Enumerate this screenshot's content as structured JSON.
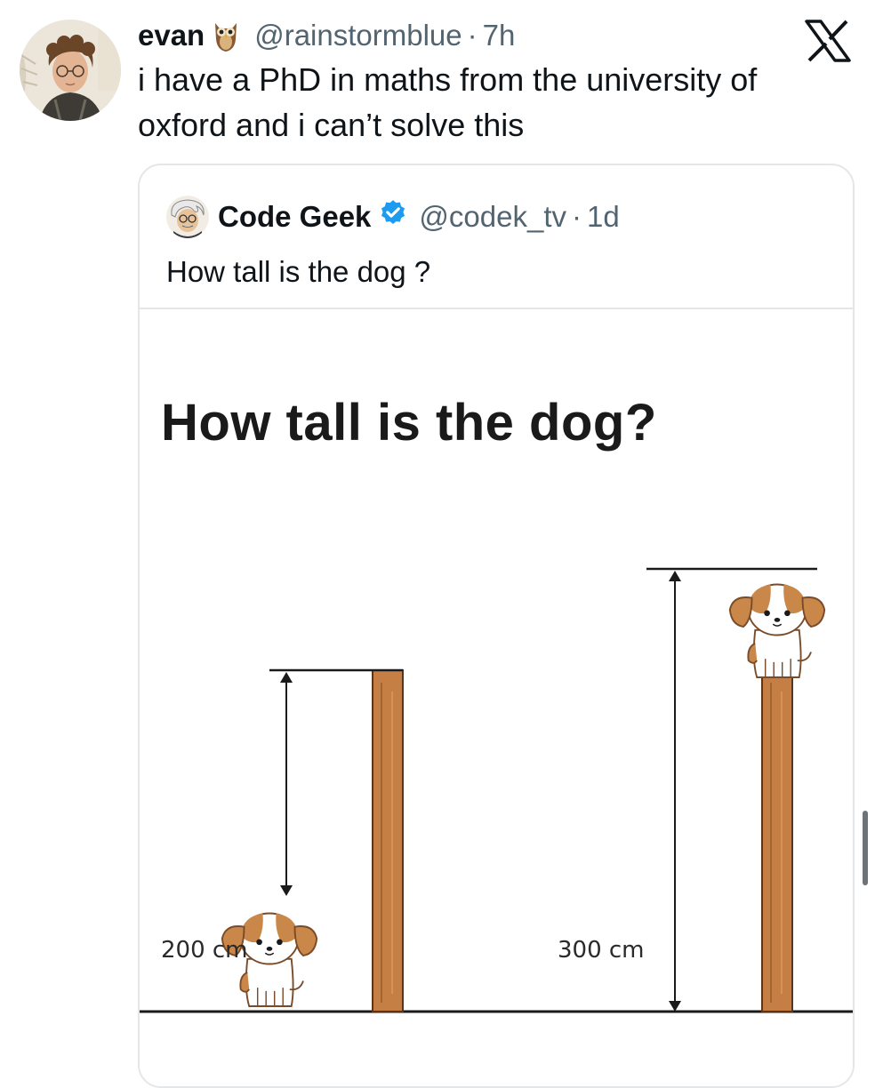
{
  "tweet": {
    "author_name": "evan",
    "author_emoji": "owl",
    "handle": "@rainstormblue",
    "separator": "·",
    "time": "7h",
    "text_line1": "i have a PhD in maths from the university of",
    "text_line2": "oxford and i can’t solve this"
  },
  "quoted_tweet": {
    "author_name": "Code Geek",
    "verified": true,
    "handle": "@codek_tv",
    "separator": "·",
    "time": "1d",
    "text": "How tall is the dog ?"
  },
  "puzzle_image": {
    "title": "How tall is the dog?",
    "left_label": "200 cm",
    "right_label": "300 cm"
  },
  "colors": {
    "text_primary": "#0f1419",
    "text_secondary": "#536471",
    "verified_blue": "#1d9bf0",
    "border": "#e3e7ea",
    "wood": "#c57f45",
    "dog_brown": "#c9874a"
  },
  "icons": {
    "close": "x-logo-icon",
    "verified": "verified-badge-icon",
    "owl": "owl-emoji-icon"
  }
}
